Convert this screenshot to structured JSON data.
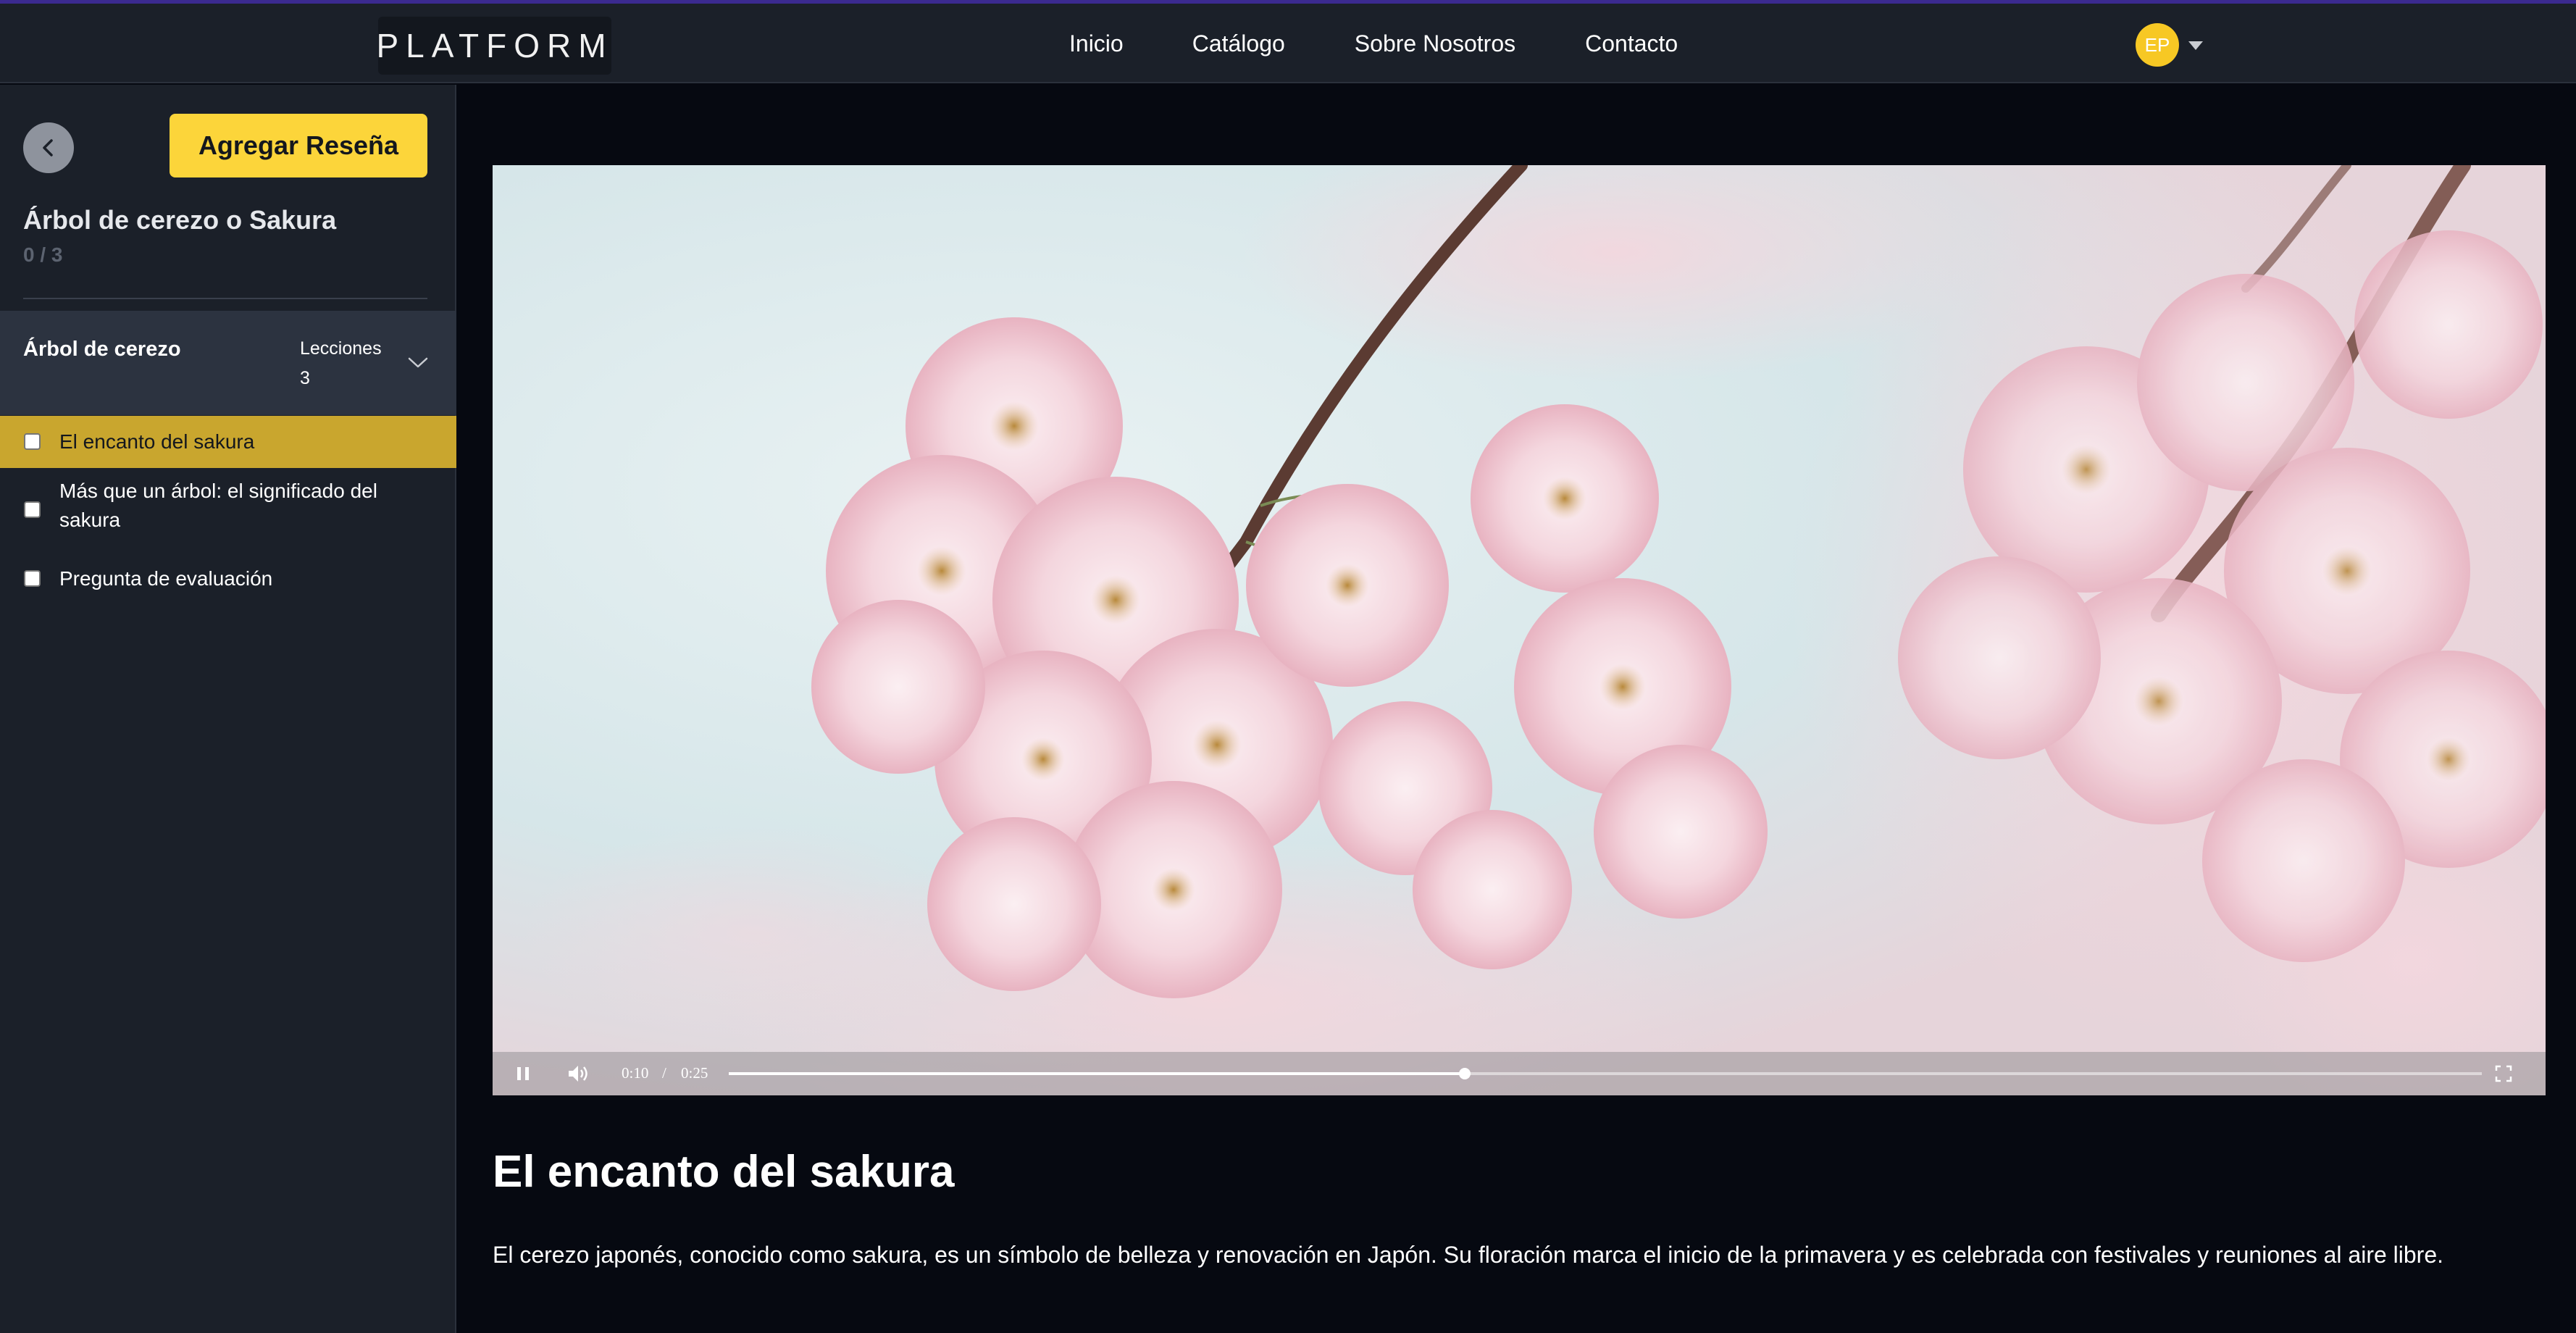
{
  "nav": {
    "logo": "PLATFORM",
    "links": [
      "Inicio",
      "Catálogo",
      "Sobre Nosotros",
      "Contacto"
    ],
    "avatar_initials": "EP",
    "avatar_color": "#f7c824"
  },
  "sidebar": {
    "review_button": "Agregar Reseña",
    "course_title": "Árbol de cerezo o Sakura",
    "progress": "0 / 3",
    "module": {
      "name": "Árbol de cerezo",
      "lessons_label": "Lecciones",
      "lessons_count": "3"
    },
    "lessons": [
      {
        "label": "El encanto del sakura",
        "active": true,
        "checked": false
      },
      {
        "label": "Más que un árbol: el significado del sakura",
        "active": false,
        "checked": false
      },
      {
        "label": "Pregunta de evaluación",
        "active": false,
        "checked": false
      }
    ]
  },
  "player": {
    "current_time": "0:10",
    "separator": "/",
    "duration": "0:25",
    "progress_fraction": 0.42,
    "state": "playing"
  },
  "main": {
    "heading": "El encanto del sakura",
    "description": "El cerezo japonés, conocido como sakura, es un símbolo de belleza y renovación en Japón. Su floración marca el inicio de la primavera y es celebrada con festivales y reuniones al aire libre."
  },
  "colors": {
    "accent_yellow": "#fcd53a",
    "active_lesson": "#c9a62e",
    "sidebar_bg": "#1b2029",
    "page_bg": "#060911"
  }
}
